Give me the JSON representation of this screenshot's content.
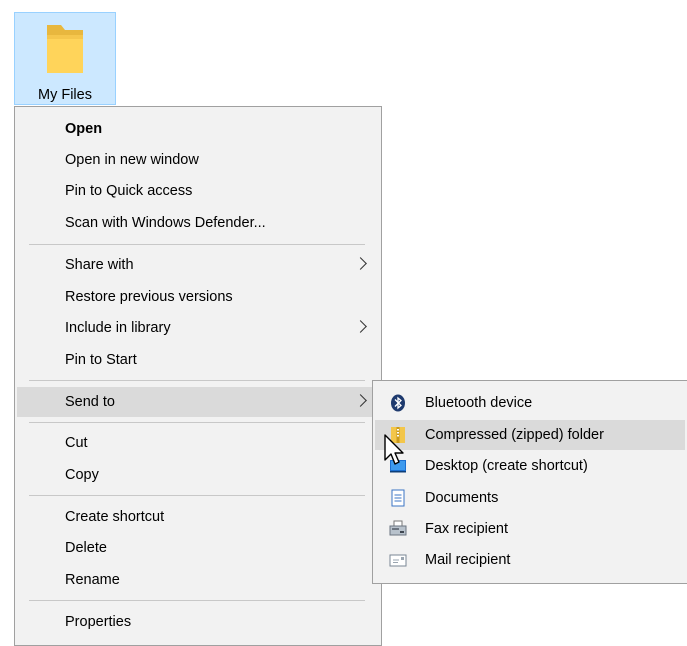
{
  "desktop": {
    "folder_label": "My Files",
    "selection_color": "#cce8ff"
  },
  "menu": {
    "items": [
      {
        "label": "Open"
      },
      {
        "label": "Open in new window"
      },
      {
        "label": "Pin to Quick access"
      },
      {
        "label": "Scan with Windows Defender..."
      },
      {
        "label": "Share with"
      },
      {
        "label": "Restore previous versions"
      },
      {
        "label": "Include in library"
      },
      {
        "label": "Pin to Start"
      },
      {
        "label": "Send to"
      },
      {
        "label": "Cut"
      },
      {
        "label": "Copy"
      },
      {
        "label": "Create shortcut"
      },
      {
        "label": "Delete"
      },
      {
        "label": "Rename"
      },
      {
        "label": "Properties"
      }
    ],
    "highlight_color": "#dadada",
    "background_color": "#f2f2f2"
  },
  "send_to": {
    "items": [
      {
        "label": "Bluetooth device",
        "icon": "bluetooth-icon"
      },
      {
        "label": "Compressed (zipped) folder",
        "icon": "zip-folder-icon"
      },
      {
        "label": "Desktop (create shortcut)",
        "icon": "desktop-icon"
      },
      {
        "label": "Documents",
        "icon": "documents-icon"
      },
      {
        "label": "Fax recipient",
        "icon": "fax-icon"
      },
      {
        "label": "Mail recipient",
        "icon": "mail-icon"
      }
    ]
  }
}
